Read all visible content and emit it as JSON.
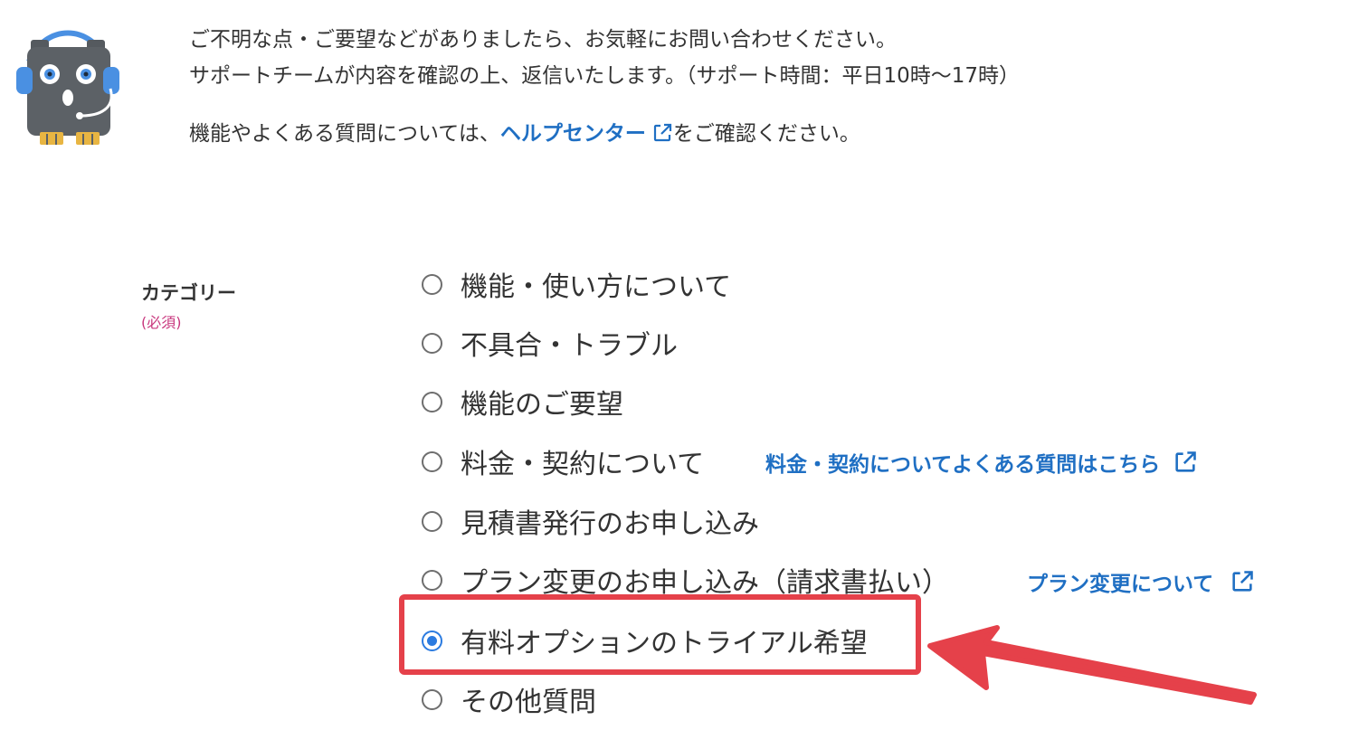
{
  "intro": {
    "line1": "ご不明な点・ご要望などがありましたら、お気軽にお問い合わせください。",
    "line2": "サポートチームが内容を確認の上、返信いたします。（サポート時間：平日10時〜17時）",
    "help_prefix": "機能やよくある質問については、",
    "help_link": "ヘルプセンター",
    "help_suffix": "をご確認ください。"
  },
  "category": {
    "label": "カテゴリー",
    "required": "(必須)",
    "selected_value": "有料オプションのトライアル希望",
    "options": [
      {
        "label": "機能・使い方について"
      },
      {
        "label": "不具合・トラブル"
      },
      {
        "label": "機能のご要望"
      },
      {
        "label": "料金・契約について",
        "link": "料金・契約についてよくある質問はこちら"
      },
      {
        "label": "見積書発行のお申し込み"
      },
      {
        "label": "プラン変更のお申し込み（請求書払い）",
        "link": "プラン変更について"
      },
      {
        "label": "有料オプションのトライアル希望",
        "checked": true
      },
      {
        "label": "その他質問"
      }
    ]
  },
  "annotation": {
    "highlight_color": "#e5414a",
    "arrow_color": "#e5414a"
  },
  "colors": {
    "link": "#1f6fc3",
    "required": "#c8367d",
    "radio_checked": "#2b7be0"
  },
  "icons": {
    "mascot": "support-headset-mascot-icon",
    "external": "external-link-icon"
  }
}
